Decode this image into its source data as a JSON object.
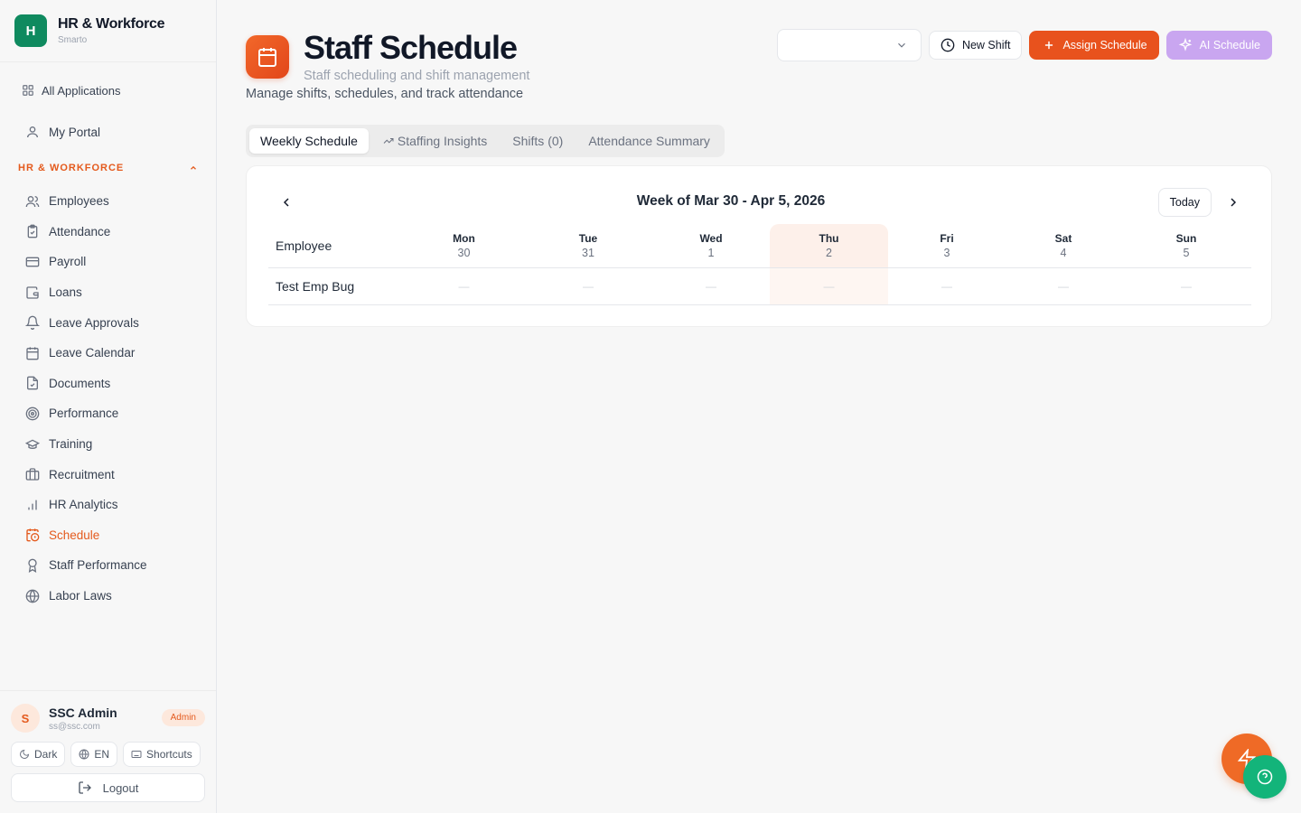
{
  "brand": {
    "logo_letter": "H",
    "title": "HR & Workforce",
    "subtitle": "Smarto"
  },
  "nav": {
    "all_apps": "All Applications",
    "portal": "My Portal",
    "section": "HR & WORKFORCE",
    "items": [
      {
        "label": "Employees",
        "icon": "users-icon"
      },
      {
        "label": "Attendance",
        "icon": "clipboard-check-icon"
      },
      {
        "label": "Payroll",
        "icon": "credit-card-icon"
      },
      {
        "label": "Loans",
        "icon": "wallet-icon"
      },
      {
        "label": "Leave Approvals",
        "icon": "bell-icon"
      },
      {
        "label": "Leave Calendar",
        "icon": "calendar-icon"
      },
      {
        "label": "Documents",
        "icon": "file-check-icon"
      },
      {
        "label": "Performance",
        "icon": "target-icon"
      },
      {
        "label": "Training",
        "icon": "graduation-cap-icon"
      },
      {
        "label": "Recruitment",
        "icon": "briefcase-icon"
      },
      {
        "label": "HR Analytics",
        "icon": "bar-chart-icon"
      },
      {
        "label": "Schedule",
        "icon": "calendar-clock-icon",
        "active": true
      },
      {
        "label": "Staff Performance",
        "icon": "award-icon"
      },
      {
        "label": "Labor Laws",
        "icon": "globe-icon"
      }
    ]
  },
  "user": {
    "initial": "S",
    "name": "SSC Admin",
    "email": "ss@ssc.com",
    "role": "Admin",
    "theme_label": "Dark",
    "lang_label": "EN",
    "shortcuts_label": "Shortcuts",
    "logout_label": "Logout"
  },
  "page": {
    "title": "Staff Schedule",
    "subtitle": "Staff scheduling and shift management",
    "description": "Manage shifts, schedules, and track attendance",
    "select_value": "",
    "new_shift_label": "New Shift",
    "assign_label": "Assign Schedule",
    "ai_label": "AI Schedule"
  },
  "tabs": [
    {
      "label": "Weekly Schedule",
      "active": true
    },
    {
      "label": "Staffing Insights"
    },
    {
      "label": "Shifts (0)"
    },
    {
      "label": "Attendance Summary"
    }
  ],
  "schedule": {
    "week_label": "Week of Mar 30 - Apr 5, 2026",
    "today_label": "Today",
    "employee_header": "Employee",
    "days": [
      {
        "name": "Mon",
        "num": "30"
      },
      {
        "name": "Tue",
        "num": "31"
      },
      {
        "name": "Wed",
        "num": "1"
      },
      {
        "name": "Thu",
        "num": "2",
        "today": true
      },
      {
        "name": "Fri",
        "num": "3"
      },
      {
        "name": "Sat",
        "num": "4"
      },
      {
        "name": "Sun",
        "num": "5"
      }
    ],
    "rows": [
      {
        "employee": "Test Emp Bug",
        "cells": [
          "—",
          "—",
          "—",
          "—",
          "—",
          "—",
          "—"
        ]
      }
    ]
  },
  "colors": {
    "accent": "#e8521d",
    "brand_green": "#0f8a5f",
    "ai_purple": "#c9a6f0",
    "help_green": "#13b47a"
  }
}
